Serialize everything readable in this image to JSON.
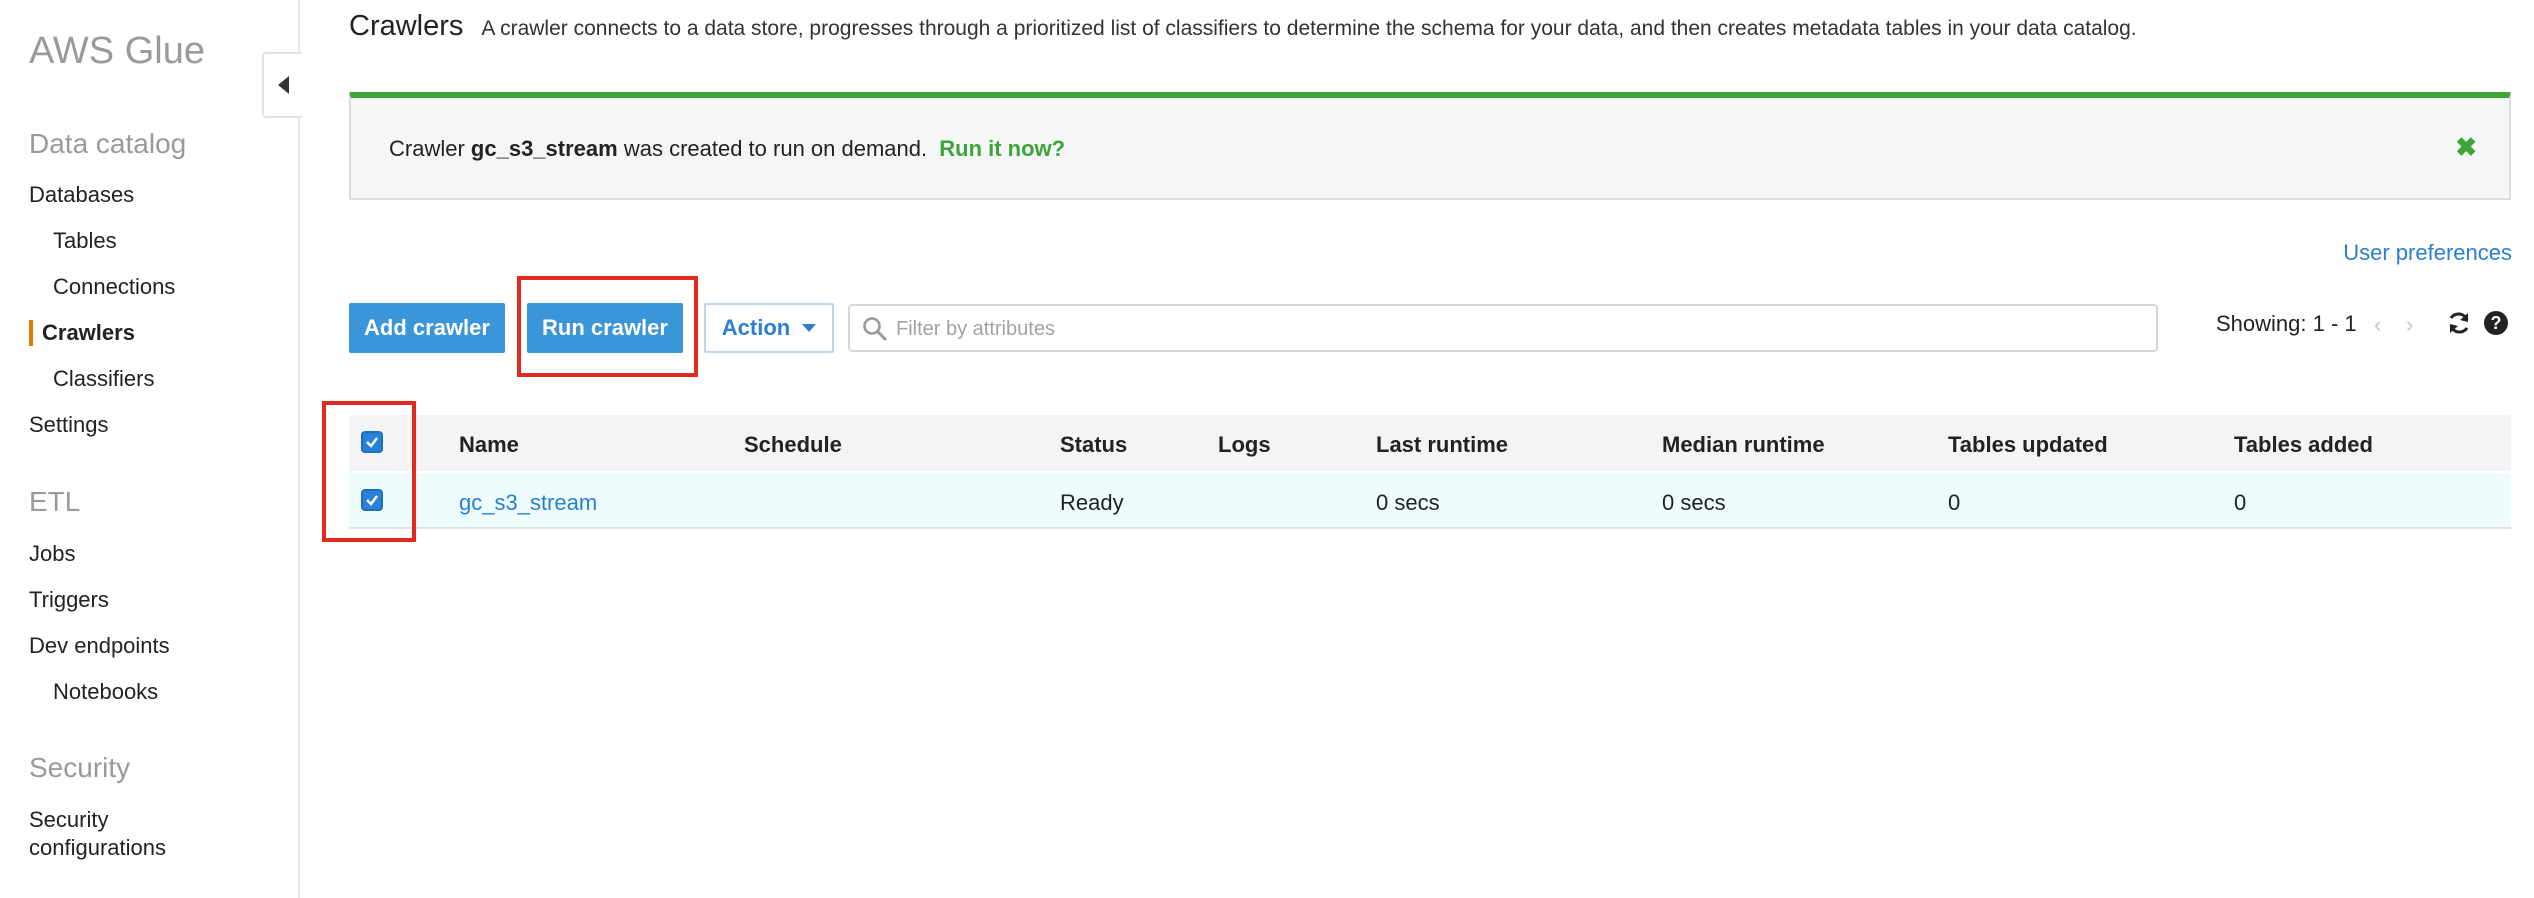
{
  "sidebar": {
    "brand": "AWS Glue",
    "sections": {
      "data_catalog": "Data catalog",
      "etl": "ETL",
      "security": "Security"
    },
    "items": {
      "databases": "Databases",
      "tables": "Tables",
      "connections": "Connections",
      "crawlers": "Crawlers",
      "classifiers": "Classifiers",
      "settings": "Settings",
      "jobs": "Jobs",
      "triggers": "Triggers",
      "dev_endpoints": "Dev endpoints",
      "notebooks": "Notebooks",
      "security_configurations_line1": "Security",
      "security_configurations_line2": "configurations"
    }
  },
  "header": {
    "title": "Crawlers",
    "description": "A crawler connects to a data store, progresses through a prioritized list of classifiers to determine the schema for your data, and then creates metadata tables in your data catalog."
  },
  "flash": {
    "prefix": "Crawler",
    "crawler_name": "gc_s3_stream",
    "suffix": "was created to run on demand.",
    "link": "Run it now?",
    "close_glyph": "✖"
  },
  "toolbar": {
    "user_preferences": "User preferences",
    "add_crawler": "Add crawler",
    "run_crawler": "Run crawler",
    "action": "Action",
    "filter_placeholder": "Filter by attributes",
    "showing": "Showing: 1 - 1",
    "prev_glyph": "‹",
    "next_glyph": "›",
    "help_glyph": "?"
  },
  "table": {
    "columns": [
      "Name",
      "Schedule",
      "Status",
      "Logs",
      "Last runtime",
      "Median runtime",
      "Tables updated",
      "Tables added"
    ],
    "rows": [
      {
        "name": "gc_s3_stream",
        "schedule": "",
        "status": "Ready",
        "logs": "",
        "last_runtime": "0 secs",
        "median_runtime": "0 secs",
        "tables_updated": "0",
        "tables_added": "0",
        "selected": true
      }
    ],
    "select_all": true
  },
  "colors": {
    "accent_blue": "#3a96d8",
    "link_blue": "#2a7fd4",
    "success_green": "#3ba53a",
    "active_orange": "#e07b00",
    "highlight_red": "#e02b20"
  }
}
